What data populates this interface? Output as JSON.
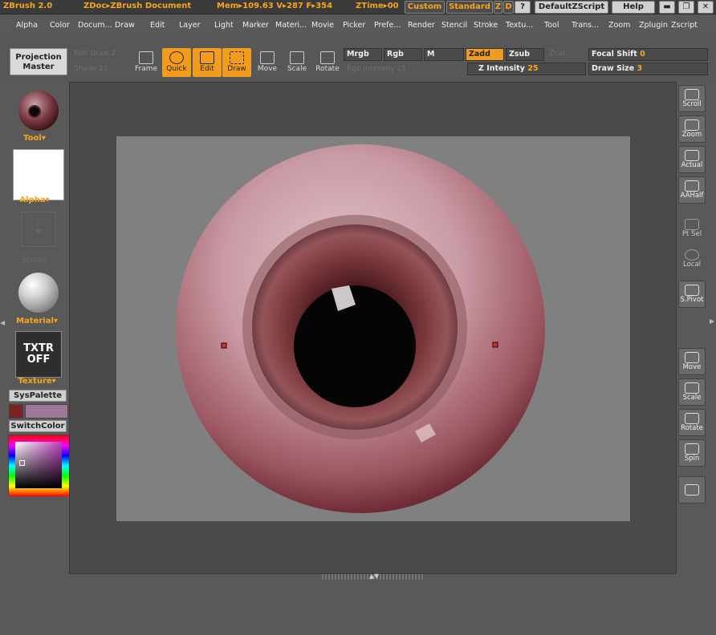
{
  "titlebar": {
    "app": "ZBrush 2.0",
    "doc": "ZDoc▸ZBrush Document",
    "mem": "Mem▸109.63 V▸287 F▸354",
    "ztime": "ZTime▸00",
    "custom": "Custom",
    "standard": "Standard",
    "z": "Z",
    "d": "D",
    "q": "?",
    "script": "DefaultZScript",
    "help": "Help"
  },
  "menu": [
    "Alpha",
    "Color",
    "Docum...",
    "Draw",
    "Edit",
    "Layer",
    "Light",
    "Marker",
    "Materi...",
    "Movie",
    "Picker",
    "Prefe...",
    "Render",
    "Stencil",
    "Stroke",
    "Textu...",
    "Tool",
    "Trans...",
    "Zoom",
    "Zplugin",
    "Zscript"
  ],
  "shelf": {
    "projection_master": "Projection Master",
    "faded_top": "Edit  Draw  2",
    "faded_bottom": "Shade 23",
    "frame": "Frame",
    "quick": "Quick",
    "edit": "Edit",
    "draw": "Draw",
    "move": "Move",
    "scale": "Scale",
    "rotate": "Rotate",
    "mrgb": "Mrgb",
    "rgb": "Rgb",
    "m": "M",
    "zadd": "Zadd",
    "zsub": "Zsub",
    "zcut": "Zcut",
    "rgb_intensity": "Rgb Intensity 15",
    "focal_shift_label": "Focal Shift",
    "focal_shift_value": "0",
    "z_intensity_label": "Z Intensity",
    "z_intensity_value": "25",
    "draw_size_label": "Draw Size",
    "draw_size_value": "3"
  },
  "lefttray": {
    "tool": "Tool",
    "alpha": "Alpha",
    "stroke": "Stroke",
    "material": "Material",
    "txtr_off": "TXTR OFF",
    "texture": "Texture",
    "syspalette": "SysPalette",
    "switchcolor": "SwitchColor",
    "main_color": "#7a2326",
    "secondary_color": "#9c7a97"
  },
  "righttray": {
    "scroll": "Scroll",
    "zoom": "Zoom",
    "actual": "Actual",
    "aahalf": "AAHalf",
    "ptsel": "Pt Sel",
    "local": "Local",
    "spivot": "S.Pivot",
    "move": "Move",
    "scale": "Scale",
    "rotate": "Rotate",
    "spin": "Spin"
  }
}
